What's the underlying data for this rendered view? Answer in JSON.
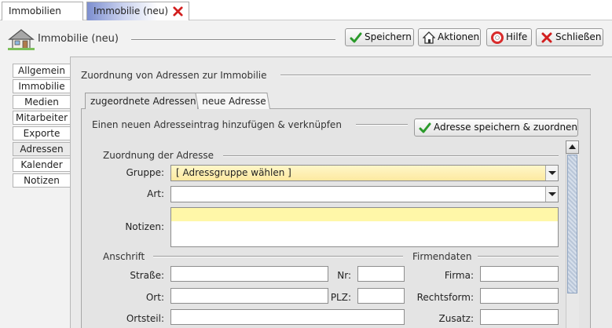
{
  "tabs": [
    {
      "label": "Immobilien"
    },
    {
      "label": "Immobilie (neu)",
      "close_icon": "close-x-icon"
    }
  ],
  "header": {
    "title": "Immobilie (neu)",
    "icon": "house-icon",
    "buttons": {
      "save": "Speichern",
      "actions": "Aktionen",
      "help": "Hilfe",
      "close": "Schließen"
    }
  },
  "sidebar": {
    "items": [
      "Allgemein",
      "Immobilie",
      "Medien",
      "Mitarbeiter",
      "Exporte",
      "Adressen",
      "Kalender",
      "Notizen"
    ],
    "selected": "Adressen"
  },
  "main": {
    "section_title": "Zuordnung von Adressen zur Immobilie",
    "inner_tabs": [
      "zugeordnete Adressen",
      "neue Adresse"
    ],
    "active_inner_tab": "neue Adresse",
    "content_header": "Einen neuen Adresseintrag hinzufügen & verknüpfen",
    "assign_button": "Adresse speichern & zuordnen",
    "assignment": {
      "title": "Zuordnung der Adresse",
      "group_label": "Gruppe:",
      "group_value": "[ Adressgruppe wählen ]",
      "type_label": "Art:",
      "type_value": "",
      "notes_label": "Notizen:",
      "notes_value": ""
    },
    "address": {
      "title": "Anschrift",
      "street_label": "Straße:",
      "nr_label": "Nr:",
      "city_label": "Ort:",
      "zip_label": "PLZ:",
      "district_label": "Ortsteil:"
    },
    "company": {
      "title": "Firmendaten",
      "firm_label": "Firma:",
      "legal_form_label": "Rechtsform:",
      "addition_label": "Zusatz:"
    }
  },
  "colors": {
    "accent_tab": "#7d8fd0",
    "highlight_field": "#fff7c0",
    "check_green": "#2a9a2a",
    "close_red": "#d21f1f"
  }
}
